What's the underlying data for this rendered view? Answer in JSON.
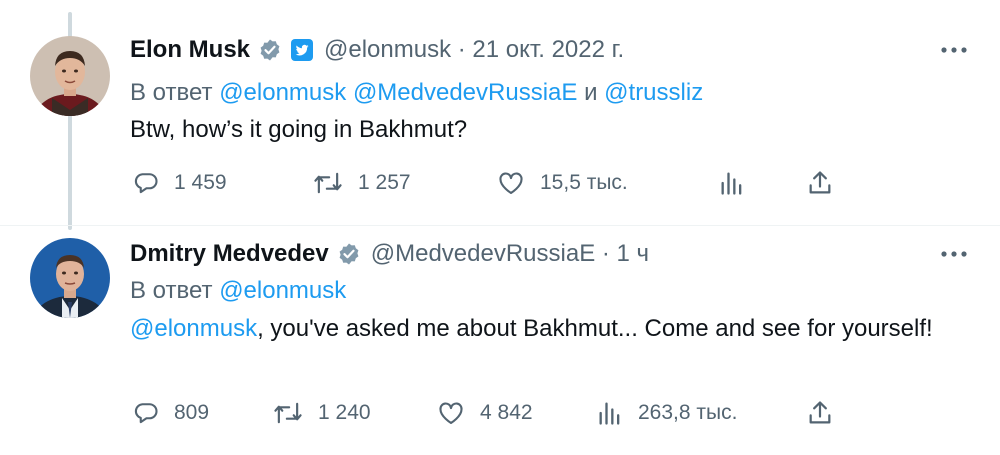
{
  "colors": {
    "accent": "#1d9bf0",
    "secondary_text": "#536471",
    "verified_badge": "#829aab",
    "thread_line": "#cfd9de"
  },
  "tweets": [
    {
      "author_name": "Elon Musk",
      "badges": [
        "verified-badge-icon",
        "twitter-affiliate-icon"
      ],
      "handle_and_time": "@elonmusk · 21 окт. 2022 г.",
      "reply_prefix": "В ответ",
      "reply_mentions": [
        "@elonmusk",
        "@MedvedevRussiaE"
      ],
      "reply_conj": "и",
      "reply_last": "@trussliz",
      "text": "Btw, how’s it going in Bakhmut?",
      "stats": {
        "replies": "1 459",
        "retweets": "1 257",
        "likes": "15,5 тыс."
      }
    },
    {
      "author_name": "Dmitry Medvedev",
      "badges": [
        "verified-badge-icon"
      ],
      "handle_and_time": "@MedvedevRussiaE · 1 ч",
      "reply_prefix": "В ответ",
      "reply_mentions": [
        "@elonmusk"
      ],
      "text_mention": "@elonmusk",
      "text": ", you've asked me about Bakhmut... Come and see for yourself!",
      "stats": {
        "replies": "809",
        "retweets": "1 240",
        "likes": "4 842",
        "views": "263,8 тыс."
      }
    }
  ]
}
